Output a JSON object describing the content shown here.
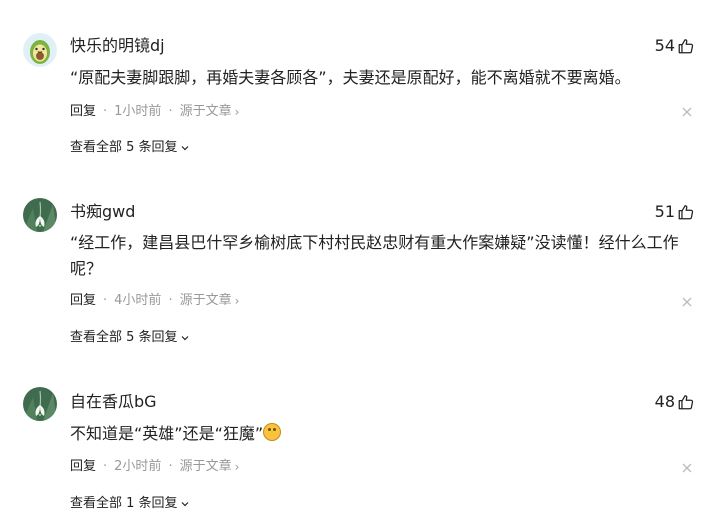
{
  "comments": [
    {
      "username": "快乐的明镜dj",
      "likes": "54",
      "text": "“原配夫妻脚跟脚，再婚夫妻各顾各”，夫妻还是原配好，能不离婚就不要离婚。",
      "reply": "回复",
      "time": "1小时前",
      "source": "源于文章",
      "view_all": "查看全部 5 条回复",
      "avatar": "avocado-avatar"
    },
    {
      "username": "书痴gwd",
      "likes": "51",
      "text": "“经工作，建昌县巴什罕乡榆树底下村村民赵忠财有重大作案嫌疑”没读懂！经什么工作呢？",
      "reply": "回复",
      "time": "4小时前",
      "source": "源于文章",
      "view_all": "查看全部 5 条回复",
      "avatar": "snowdrop-flower-avatar"
    },
    {
      "username": "自在香瓜bG",
      "likes": "48",
      "text": "不知道是“英雄”还是“狂魔”",
      "reply": "回复",
      "time": "2小时前",
      "source": "源于文章",
      "view_all": "查看全部 1 条回复",
      "avatar": "snowdrop-flower-avatar",
      "emoji": "grimacing-face-emoji"
    }
  ],
  "colors": {
    "text": "#222222",
    "meta": "#999999",
    "background": "#ffffff"
  }
}
